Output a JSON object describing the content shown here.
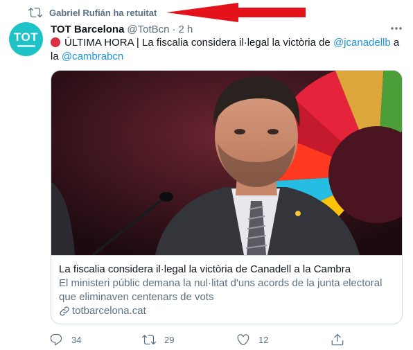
{
  "retweet_banner": {
    "text": "Gabriel Rufián ha retuitat",
    "icon": "retweet-icon"
  },
  "avatar": {
    "logo_text": "TOT",
    "color": "#1dc3c6"
  },
  "tweet": {
    "display_name": "TOT Barcelona",
    "handle": "@TotBcn",
    "separator": "·",
    "time": "2 h",
    "more_icon": "more-icon",
    "text_prefix": "ÚLTIMA HORA | La fiscalia considera il·legal la victòria de ",
    "mention_1": "@jcanadellb",
    "text_mid": " a la ",
    "mention_2": "@cambrabcn"
  },
  "card": {
    "title": "La fiscalia considera il·legal la victòria de Canadell a la Cambra",
    "description": "El ministeri públic demana la nul·litat d'uns acords de la junta electoral que eliminaven centenars de vots",
    "domain": "totbarcelona.cat"
  },
  "actions": {
    "reply_count": "34",
    "retweet_count": "29",
    "like_count": "12"
  },
  "colors": {
    "link": "#1b95e0",
    "secondary_text": "#5b7083",
    "annotation_arrow": "#e3121b",
    "alert_dot": "#dd2e44"
  }
}
